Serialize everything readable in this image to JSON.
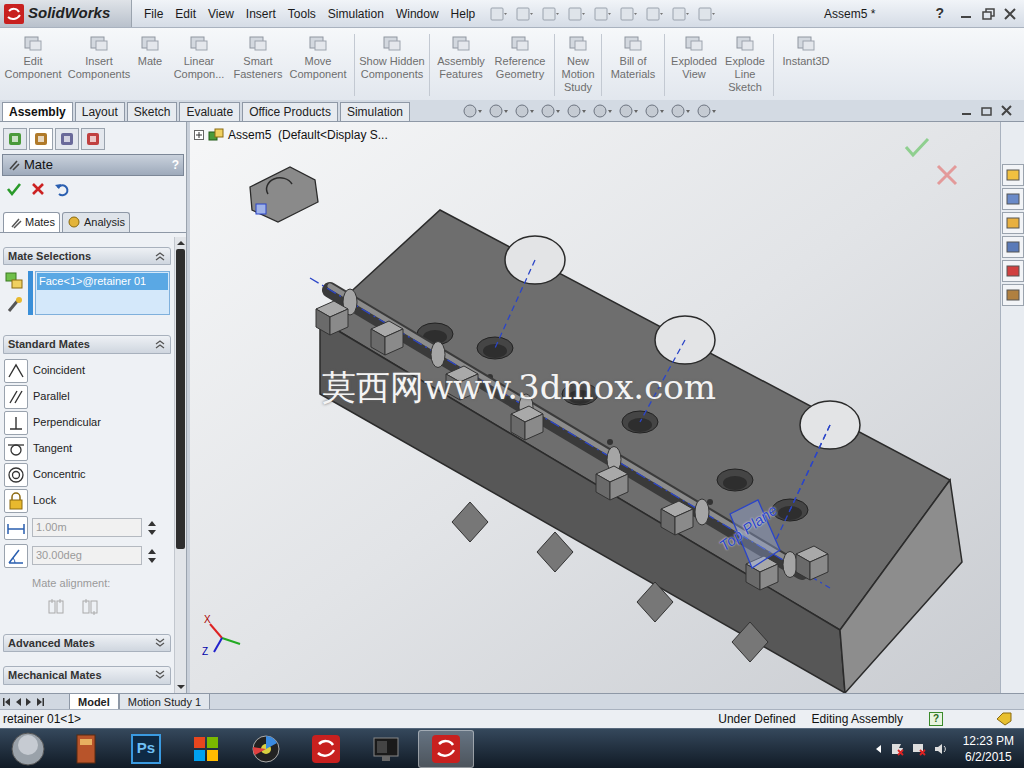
{
  "window": {
    "app": "SolidWorks",
    "title": "Assem5 *",
    "help": "?"
  },
  "menu": [
    "File",
    "Edit",
    "View",
    "Insert",
    "Tools",
    "Simulation",
    "Window",
    "Help"
  ],
  "ribbon": [
    {
      "label": "Edit Component"
    },
    {
      "label": "Insert Components"
    },
    {
      "label": "Mate"
    },
    {
      "label": "Linear Compon..."
    },
    {
      "label": "Smart Fasteners"
    },
    {
      "label": "Move Component"
    },
    {
      "label": "Show Hidden Components"
    },
    {
      "label": "Assembly Features"
    },
    {
      "label": "Reference Geometry"
    },
    {
      "label": "New Motion Study"
    },
    {
      "label": "Bill of Materials"
    },
    {
      "label": "Exploded View"
    },
    {
      "label": "Explode Line Sketch"
    },
    {
      "label": "Instant3D"
    }
  ],
  "tabs": [
    {
      "label": "Assembly",
      "selected": true
    },
    {
      "label": "Layout",
      "selected": false
    },
    {
      "label": "Sketch",
      "selected": false
    },
    {
      "label": "Evaluate",
      "selected": false
    },
    {
      "label": "Office Products",
      "selected": false
    },
    {
      "label": "Simulation",
      "selected": false
    }
  ],
  "panel": {
    "title": "Mate",
    "help": "?",
    "subtabs": [
      {
        "label": "Mates",
        "selected": true
      },
      {
        "label": "Analysis",
        "selected": false
      }
    ],
    "mate_selections": {
      "title": "Mate Selections",
      "items": [
        {
          "label": "Face<1>@retainer 01",
          "selected": true
        }
      ]
    },
    "standard_mates": {
      "title": "Standard Mates",
      "items": [
        {
          "label": "Coincident"
        },
        {
          "label": "Parallel"
        },
        {
          "label": "Perpendicular"
        },
        {
          "label": "Tangent"
        },
        {
          "label": "Concentric"
        },
        {
          "label": "Lock"
        }
      ],
      "distance": {
        "value": "1.00m",
        "disabled": true
      },
      "angle": {
        "value": "30.00deg",
        "disabled": true
      },
      "alignment_label": "Mate alignment:"
    },
    "collapsed_sections": [
      {
        "title": "Advanced Mates",
        "expanded": false
      },
      {
        "title": "Mechanical Mates",
        "expanded": false
      }
    ]
  },
  "viewport": {
    "tree_root": "Assem5  (Default<Display S...",
    "watermark": "莫西网www.3dmox.com",
    "plane_label": "Top Plane",
    "axes": {
      "x": "X",
      "z": "Z"
    }
  },
  "bottom_tabs": [
    {
      "label": "Model",
      "selected": true
    },
    {
      "label": "Motion Study 1",
      "selected": false
    }
  ],
  "status_bar": {
    "component": "retainer 01<1>",
    "state": "Under Defined",
    "mode": "Editing Assembly",
    "help": "?"
  },
  "taskbar": {
    "ps_label": "Ps",
    "time": "12:23 PM",
    "date": "6/2/2015"
  }
}
